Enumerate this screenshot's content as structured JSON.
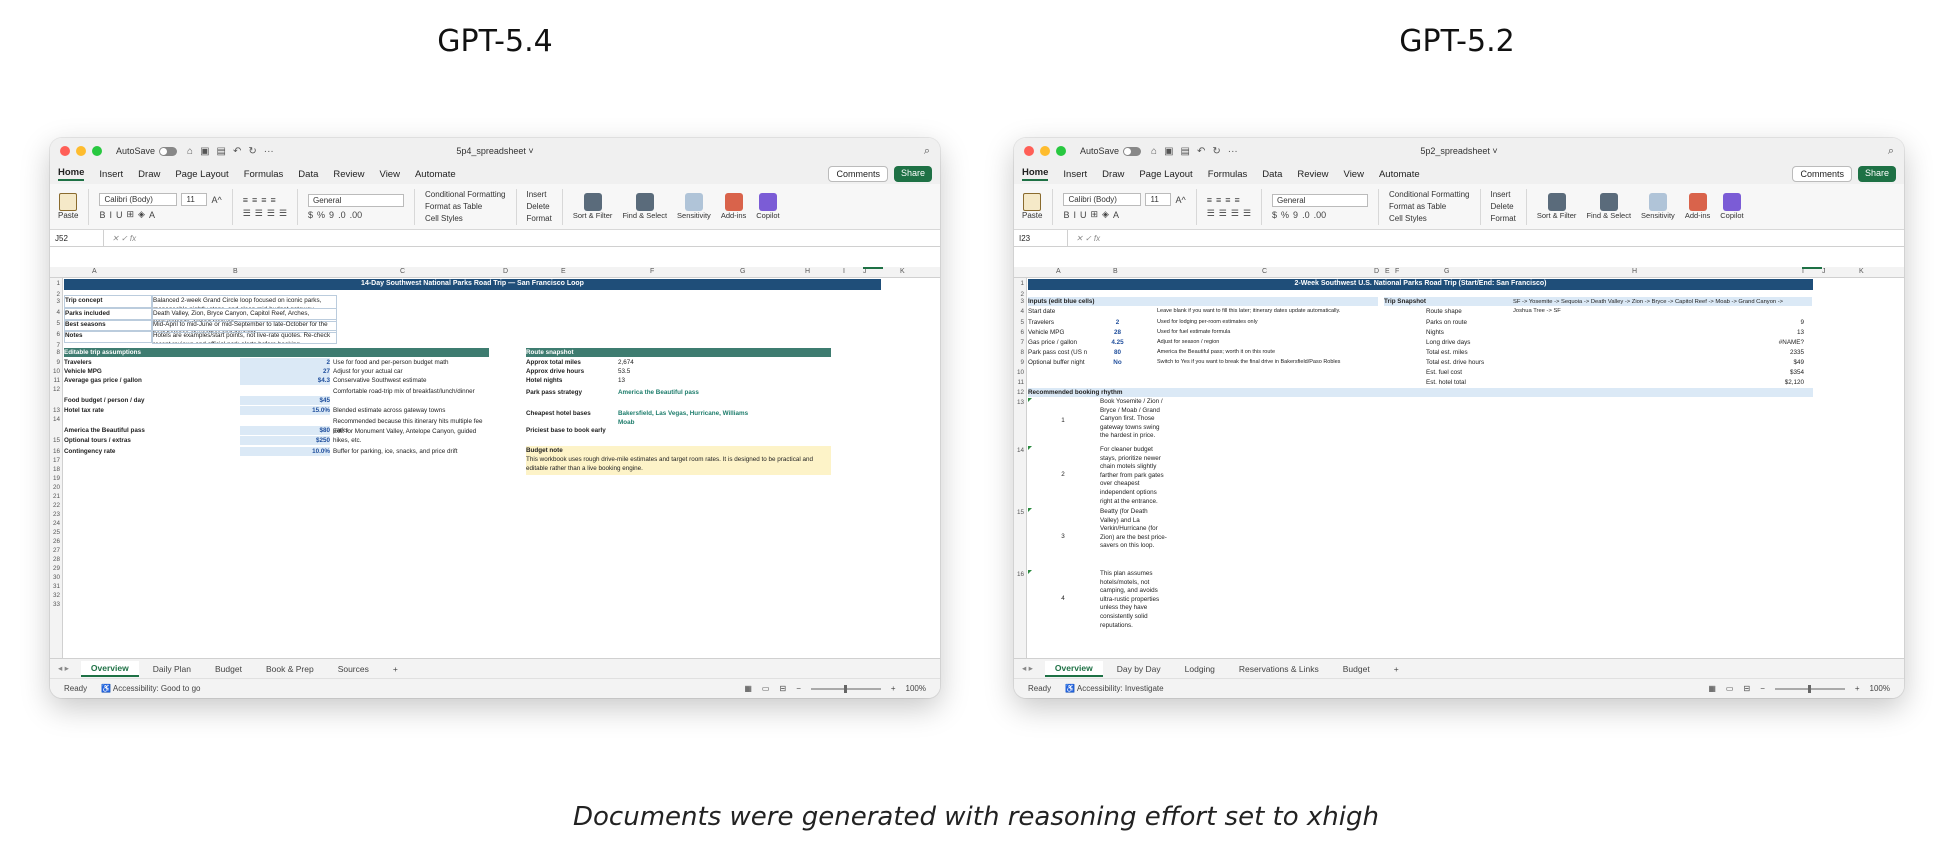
{
  "left_title": "GPT-5.4",
  "right_title": "GPT-5.2",
  "caption": "Documents were generated with reasoning effort set to xhigh",
  "common": {
    "autosave": "AutoSave",
    "menu_tabs": [
      "Home",
      "Insert",
      "Draw",
      "Page Layout",
      "Formulas",
      "Data",
      "Review",
      "View",
      "Automate"
    ],
    "comments": "Comments",
    "share": "Share",
    "paste": "Paste",
    "font": "Calibri (Body)",
    "font_size": "11",
    "number_format": "General",
    "cond_format": "Conditional Formatting",
    "format_table": "Format as Table",
    "cell_styles": "Cell Styles",
    "insert": "Insert",
    "delete": "Delete",
    "format": "Format",
    "sort_filter": "Sort & Filter",
    "find_select": "Find & Select",
    "sensitivity": "Sensitivity",
    "addins": "Add-ins",
    "copilot": "Copilot",
    "ready": "Ready",
    "zoom": "100%"
  },
  "left": {
    "filename": "5p4_spreadsheet",
    "namebox": "J52",
    "accessibility": "Accessibility: Good to go",
    "sheets": [
      "Overview",
      "Daily Plan",
      "Budget",
      "Book & Prep",
      "Sources"
    ],
    "banner": "14-Day Southwest National Parks Road Trip — San Francisco Loop",
    "info": [
      {
        "label": "Trip concept",
        "value": "Balanced 2-week Grand Circle loop focused on iconic parks, manageable nightly stops, and clean mid-budget gateway"
      },
      {
        "label": "Parks included",
        "value": "Death Valley, Zion, Bryce Canyon, Capitol Reef, Arches, Canyonlands, Grand Canyon"
      },
      {
        "label": "Best seasons",
        "value": "Mid-April to mid-June or mid-September to late-October for the best balance of weather and daylight."
      },
      {
        "label": "Notes",
        "value": "Hotels are examples/start points, not live-rate quotes. Re-check recent reviews and official park alerts before booking."
      }
    ],
    "assumptions_header": "Editable trip assumptions",
    "assumptions": [
      {
        "label": "Travelers",
        "value": "2",
        "note": "Use for food and per-person budget math"
      },
      {
        "label": "Vehicle MPG",
        "value": "27",
        "note": "Adjust for your actual car"
      },
      {
        "label": "Average gas price / gallon",
        "value": "$4.3",
        "note": "Conservative Southwest estimate"
      },
      {
        "label": "Food budget / person / day",
        "value": "$45",
        "note": "Comfortable road-trip mix of breakfast/lunch/dinner"
      },
      {
        "label": "Hotel tax rate",
        "value": "15.0%",
        "note": "Blended estimate across gateway towns"
      },
      {
        "label": "America the Beautiful pass",
        "value": "$80",
        "note": "Recommended because this itinerary hits multiple fee parks"
      },
      {
        "label": "Optional tours / extras",
        "value": "$250",
        "note": "Edit for Monument Valley, Antelope Canyon, guided hikes, etc."
      },
      {
        "label": "Contingency rate",
        "value": "10.0%",
        "note": "Buffer for parking, ice, snacks, and price drift"
      }
    ],
    "snapshot_header": "Route snapshot",
    "snapshot": [
      {
        "label": "Approx total miles",
        "value": "2,674"
      },
      {
        "label": "Approx drive hours",
        "value": "53.5"
      },
      {
        "label": "Hotel nights",
        "value": "13"
      },
      {
        "label": "Park pass strategy",
        "value": "America the Beautiful pass"
      },
      {
        "label": "Cheapest hotel bases",
        "value": "Bakersfield, Las Vegas, Hurricane, Williams"
      },
      {
        "label": "Priciest base to book early",
        "value": "Moab"
      }
    ],
    "budget_note_header": "Budget note",
    "budget_note": "This workbook uses rough drive-mile estimates and target room rates. It is designed to be practical and editable rather than a live booking engine.",
    "columns": [
      "A",
      "B",
      "C",
      "D",
      "E",
      "F",
      "G",
      "H",
      "I",
      "J",
      "K"
    ],
    "rows": [
      "1",
      "2",
      "3",
      "4",
      "5",
      "6",
      "7",
      "8",
      "9",
      "10",
      "11",
      "12",
      "13",
      "14",
      "15",
      "16",
      "17",
      "18",
      "19",
      "20",
      "21",
      "22",
      "23",
      "24",
      "25",
      "26",
      "27",
      "28",
      "29",
      "30",
      "31",
      "32",
      "33"
    ]
  },
  "right": {
    "filename": "5p2_spreadsheet",
    "namebox": "I23",
    "accessibility": "Accessibility: Investigate",
    "sheets": [
      "Overview",
      "Day by Day",
      "Lodging",
      "Reservations & Links",
      "Budget"
    ],
    "banner": "2-Week Southwest U.S. National Parks Road Trip (Start/End: San Francisco)",
    "inputs_header": "Inputs (edit blue cells)",
    "snapshot_header": "Trip Snapshot",
    "inputs": [
      {
        "label": "Start date",
        "value": "",
        "note": "Leave blank if you want to fill this later; itinerary dates update automatically."
      },
      {
        "label": "Travelers",
        "value": "2",
        "note": "Used for lodging per-room estimates only"
      },
      {
        "label": "Vehicle MPG",
        "value": "28",
        "note": "Used for fuel estimate formula"
      },
      {
        "label": "Gas price / gallon",
        "value": "4.25",
        "note": "Adjust for season / region"
      },
      {
        "label": "Park pass cost (US n",
        "value": "80",
        "note": "America the Beautiful pass; worth it on this route"
      },
      {
        "label": "Optional buffer night",
        "value": "No",
        "note": "Switch to Yes if you want to break the final drive in Bakersfield/Paso Robles"
      }
    ],
    "snapshot": [
      {
        "label": "Route shape",
        "value": "SF -> Yosemite -> Sequoia -> Death Valley -> Zion -> Bryce -> Capitol Reef -> Moab -> Grand Canyon -> Joshua Tree -> SF"
      },
      {
        "label": "Parks on route",
        "value": "9"
      },
      {
        "label": "Nights",
        "value": "13"
      },
      {
        "label": "Long drive days",
        "value": "#NAME?"
      },
      {
        "label": "Total est. miles",
        "value": "2335"
      },
      {
        "label": "Total est. drive hours",
        "value": "$49"
      },
      {
        "label": "Est. fuel cost",
        "value": "$354"
      },
      {
        "label": "Est. hotel total",
        "value": "$2,120"
      }
    ],
    "rhythm_header": "Recommended booking rhythm",
    "rhythm": [
      {
        "n": "1",
        "text": "Book Yosemite / Zion / Bryce / Moab / Grand Canyon first. Those gateway towns swing the hardest in price."
      },
      {
        "n": "2",
        "text": "For cleaner budget stays, prioritize newer chain motels slightly farther from park gates over cheapest independent options right at the entrance."
      },
      {
        "n": "3",
        "text": "Beatty (for Death Valley) and La Verkin/Hurricane (for Zion) are the best price-savers on this loop."
      },
      {
        "n": "4",
        "text": "This plan assumes hotels/motels, not camping, and avoids ultra-rustic properties unless they have consistently solid reputations."
      }
    ],
    "columns": [
      "A",
      "B",
      "C",
      "D",
      "E",
      "F",
      "G",
      "H",
      "I",
      "J",
      "K"
    ],
    "rows": [
      "1",
      "2",
      "3",
      "4",
      "5",
      "6",
      "7",
      "8",
      "9",
      "10",
      "11",
      "12",
      "13",
      "14",
      "15",
      "16"
    ]
  }
}
